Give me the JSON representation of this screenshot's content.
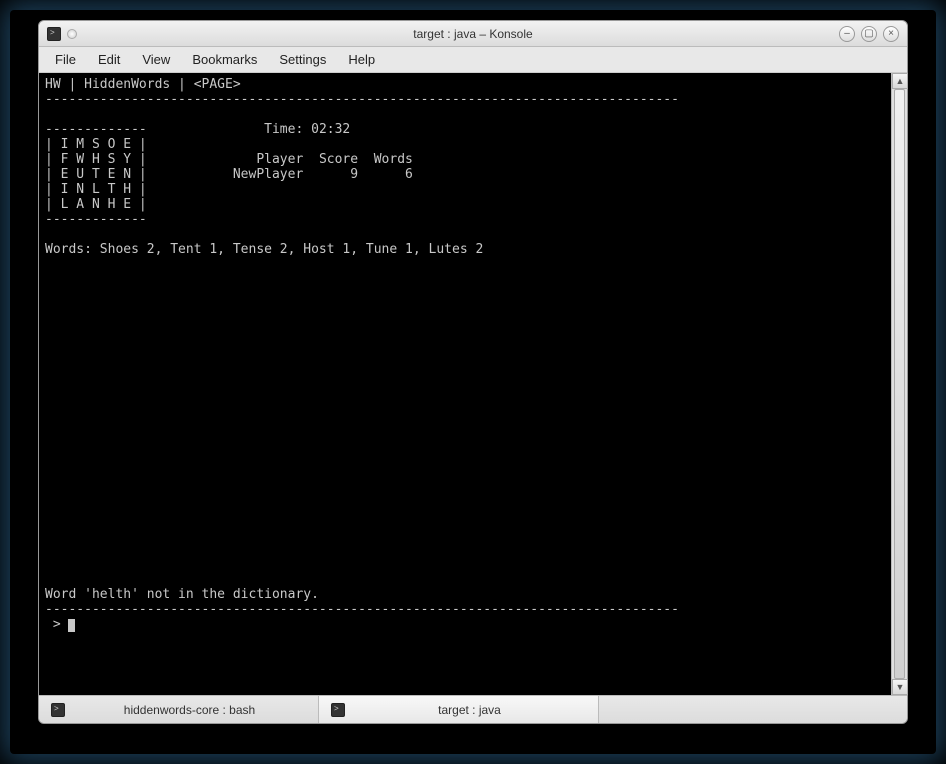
{
  "window": {
    "title": "target : java – Konsole"
  },
  "menubar": {
    "file": "File",
    "edit": "Edit",
    "view": "View",
    "bookmarks": "Bookmarks",
    "settings": "Settings",
    "help": "Help"
  },
  "terminal": {
    "header_line": "HW | HiddenWords | <PAGE>",
    "divider": "---------------------------------------------------------------------------------",
    "board_top": "-------------",
    "time_label": "Time: 02:32",
    "board_row1": "| I M S O E |",
    "board_row2": "| F W H S Y |",
    "score_header": "Player  Score  Words",
    "board_row3": "| E U T E N |",
    "score_row": "NewPlayer      9      6",
    "board_row4": "| I N L T H |",
    "board_row5": "| L A N H E |",
    "board_bottom": "-------------",
    "words_line": "Words: Shoes 2, Tent 1, Tense 2, Host 1, Tune 1, Lutes 2",
    "error_line": "Word 'helth' not in the dictionary.",
    "prompt": " > "
  },
  "tabs": {
    "tab1": "hiddenwords-core : bash",
    "tab2": "target : java"
  }
}
